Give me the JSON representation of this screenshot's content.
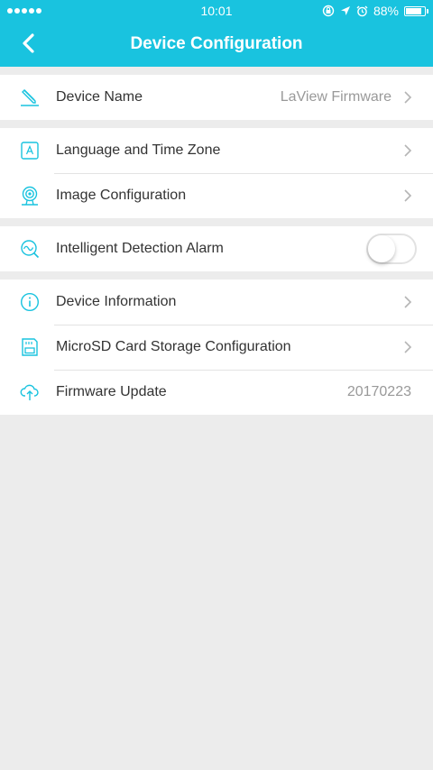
{
  "status_bar": {
    "time": "10:01",
    "battery": "88%",
    "battery_level": 0.88
  },
  "header": {
    "title": "Device Configuration"
  },
  "sections": {
    "device": {
      "device_name_label": "Device Name",
      "device_name_value": "LaView Firmware"
    },
    "settings": {
      "language_label": "Language and Time Zone",
      "image_label": "Image Configuration"
    },
    "alarm": {
      "label": "Intelligent Detection Alarm",
      "enabled": false
    },
    "info": {
      "device_info_label": "Device Information",
      "microsd_label": "MicroSD Card Storage Configuration",
      "firmware_label": "Firmware Update",
      "firmware_value": "20170223"
    }
  },
  "colors": {
    "accent": "#19c3df",
    "background": "#ececec"
  }
}
